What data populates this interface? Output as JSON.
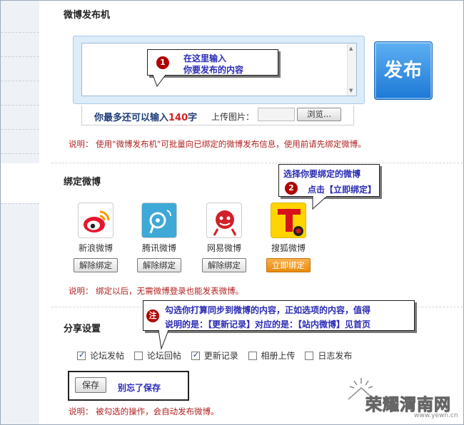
{
  "publisher": {
    "title": "微博发布机",
    "textarea_placeholder": "",
    "counter_prefix": "你最多还可以输入",
    "counter_number": "140",
    "counter_suffix": "字",
    "upload_label": "上传图片：",
    "browse_label": "浏览...",
    "publish_label": "发布",
    "note": "说明： 使用\"微博发布机\"可批量向已绑定的微博发布信息，使用前请先绑定微博。"
  },
  "callout1": {
    "number": "1",
    "line1": "在这里输入",
    "line2": "你要发布的内容"
  },
  "binding": {
    "title": "绑定微博",
    "platforms": [
      {
        "name": "新浪微博",
        "button": "解除绑定",
        "icon": "sina-weibo-icon"
      },
      {
        "name": "腾讯微博",
        "button": "解除绑定",
        "icon": "tencent-weibo-icon"
      },
      {
        "name": "网易微博",
        "button": "解除绑定",
        "icon": "netease-weibo-icon"
      },
      {
        "name": "搜狐微博",
        "button": "立即绑定",
        "icon": "sohu-weibo-icon"
      }
    ],
    "note": "说明： 绑定以后，无需微博登录也能发表微博。"
  },
  "callout2": {
    "number": "2",
    "line1": "选择你要绑定的微博",
    "line2": "点击【立即绑定】"
  },
  "share": {
    "title": "分享设置",
    "options": [
      {
        "label": "论坛发帖",
        "checked": true
      },
      {
        "label": "论坛回帖",
        "checked": false
      },
      {
        "label": "更新记录",
        "checked": true
      },
      {
        "label": "相册上传",
        "checked": false
      },
      {
        "label": "日志发布",
        "checked": false
      }
    ],
    "save_label": "保存",
    "save_hint": "别忘了保存",
    "note": "说明： 被勾选的操作，会自动发布微博。"
  },
  "callout3": {
    "badge": "注",
    "line1": "勾选你打算同步到微博的内容，正如选项的内容，值得",
    "line2": "说明的是：【更新记录】对应的是：【站内微博】见首页"
  },
  "watermark": {
    "text": "荣耀渭南网",
    "url": "www.yewn.cn"
  },
  "colors": {
    "publish_blue": "#1d79d6",
    "bind_orange": "#e98a0c",
    "note_red": "#b22222",
    "callout_text": "#2a2ab5"
  }
}
